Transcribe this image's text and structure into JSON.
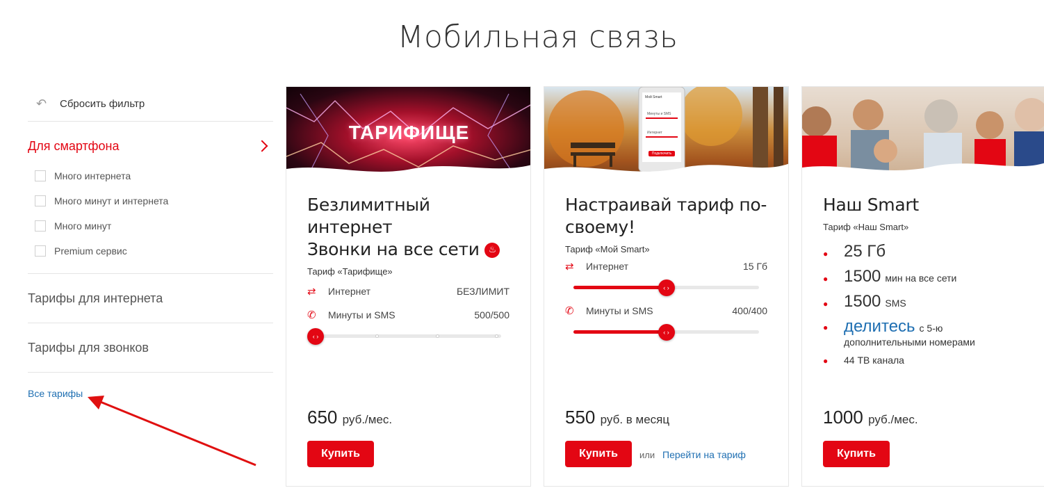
{
  "page": {
    "title": "Мобильная связь"
  },
  "sidebar": {
    "reset_label": "Сбросить фильтр",
    "active_section": "Для смартфона",
    "filters": [
      "Много интернета",
      "Много минут и интернета",
      "Много минут",
      "Premium сервис"
    ],
    "sections": [
      "Тарифы для интернета",
      "Тарифы для звонков"
    ],
    "all_link": "Все тарифы"
  },
  "cards": [
    {
      "banner_text": "ТАРИФИЩЕ",
      "title_lines": [
        "Безлимитный",
        "интернет",
        "Звонки на все сети"
      ],
      "tarif": "Тариф «Тарифище»",
      "opts": [
        {
          "label": "Интернет",
          "value": "БЕЗЛИМИТ"
        },
        {
          "label": "Минуты и SMS",
          "value": "500/500"
        }
      ],
      "slider_level": 0,
      "price_value": "650",
      "price_unit": "руб./мес.",
      "buy": "Купить"
    },
    {
      "phone_lines": [
        "Мой Smart",
        "Минуты и SMS",
        "Интернет",
        "Подключить"
      ],
      "title_lines": [
        "Настраивай тариф по-",
        "своему!"
      ],
      "tarif": "Тариф «Мой Smart»",
      "opts": [
        {
          "label": "Интернет",
          "value": "15 Гб"
        },
        {
          "label": "Минуты и SMS",
          "value": "400/400"
        }
      ],
      "slider_level": 0.5,
      "price_value": "550",
      "price_unit": "руб. в месяц",
      "buy": "Купить",
      "or": "или",
      "goto": "Перейти на тариф"
    },
    {
      "title_lines": [
        "Наш Smart"
      ],
      "tarif": "Тариф «Наш Smart»",
      "bullets": [
        {
          "big": "25 Гб",
          "small": ""
        },
        {
          "big": "1500",
          "small": "мин на все сети"
        },
        {
          "big": "1500",
          "small": "SMS"
        },
        {
          "blue": "делитесь",
          "small": "с 5-ю",
          "small2": "дополнительными номерами"
        },
        {
          "big": "",
          "small": "44 ТВ канала"
        }
      ],
      "price_value": "1000",
      "price_unit": "руб./мес.",
      "buy": "Купить"
    }
  ],
  "colors": {
    "accent": "#e30613",
    "link": "#1f6fb2"
  }
}
